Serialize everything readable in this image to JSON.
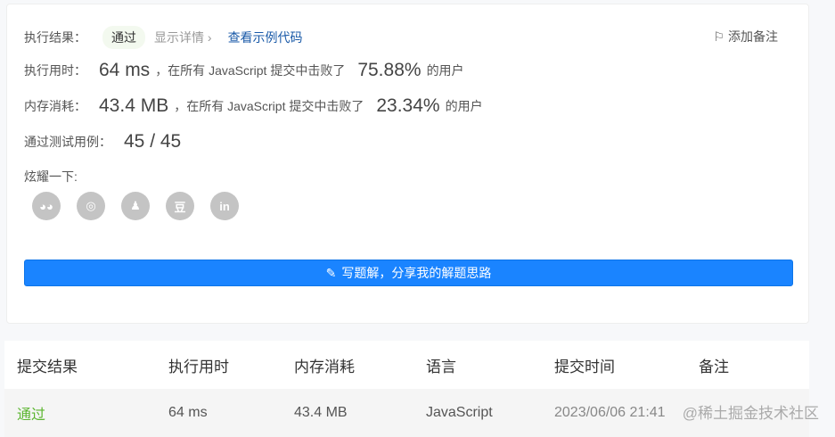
{
  "result": {
    "label": "执行结果：",
    "status": "通过",
    "details": "显示详情 ›",
    "example": "查看示例代码",
    "add_note": "添加备注"
  },
  "runtime": {
    "label": "执行用时：",
    "value": "64 ms",
    "text": "，在所有 JavaScript 提交中击败了",
    "percent": "75.88%",
    "suffix": "的用户"
  },
  "memory": {
    "label": "内存消耗：",
    "value": "43.4 MB",
    "text": "，在所有 JavaScript 提交中击败了",
    "percent": "23.34%",
    "suffix": "的用户"
  },
  "tests": {
    "label": "通过测试用例：",
    "value": "45 / 45"
  },
  "share": {
    "label": "炫耀一下:",
    "icons": [
      "wechat-icon",
      "weibo-icon",
      "qq-icon",
      "douban-icon",
      "linkedin-icon"
    ]
  },
  "write_button": "写题解，分享我的解题思路",
  "table": {
    "headers": [
      "提交结果",
      "执行用时",
      "内存消耗",
      "语言",
      "提交时间",
      "备注"
    ],
    "row": [
      "通过",
      "64 ms",
      "43.4 MB",
      "JavaScript",
      "2023/06/06 21:41"
    ]
  },
  "watermark": "@稀土掘金技术社区"
}
